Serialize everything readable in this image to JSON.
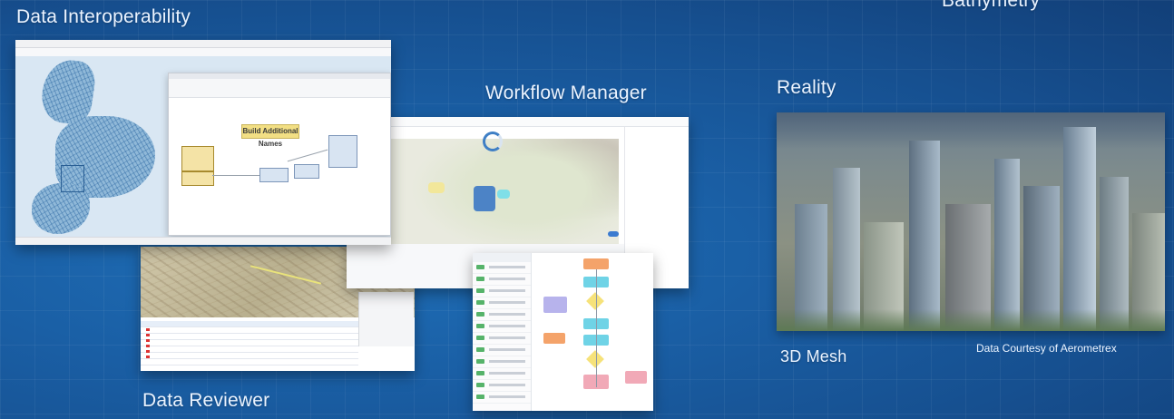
{
  "labels": {
    "data_interoperability": "Data Interoperability",
    "workflow_manager": "Workflow Manager",
    "reality": "Reality",
    "data_reviewer": "Data Reviewer",
    "mesh_3d": "3D Mesh",
    "courtesy": "Data Courtesy of Aerometrex",
    "bathymetry": "Bathymetry"
  },
  "fme_canvas": {
    "banner_text": "Build Additional Names"
  },
  "colors": {
    "background": "#1a5fa5",
    "label_text": "#eaf3ff",
    "fc_orange": "#f4a36a",
    "fc_cyan": "#6fd3e6",
    "fc_yellow": "#f6e27a",
    "fc_purple": "#b7b3ec",
    "fc_pink": "#f1a9b7"
  }
}
